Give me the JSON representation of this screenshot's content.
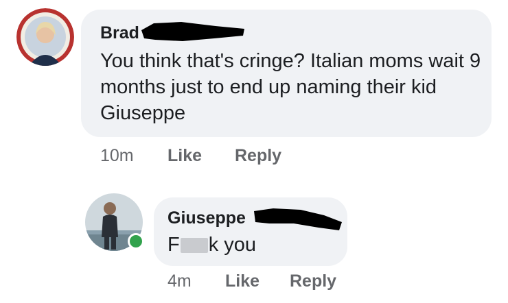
{
  "comments": [
    {
      "author": "Brad",
      "text": "You think that's cringe? Italian moms wait 9 months just to end up naming their kid Giuseppe",
      "time": "10m",
      "like_label": "Like",
      "reply_label": "Reply"
    },
    {
      "author": "Giuseppe",
      "text_start": "F",
      "text_end": "k you",
      "time": "4m",
      "like_label": "Like",
      "reply_label": "Reply",
      "online": true
    }
  ],
  "colors": {
    "bubble": "#f0f2f5",
    "meta_text": "#65676b",
    "online": "#31a24c"
  }
}
